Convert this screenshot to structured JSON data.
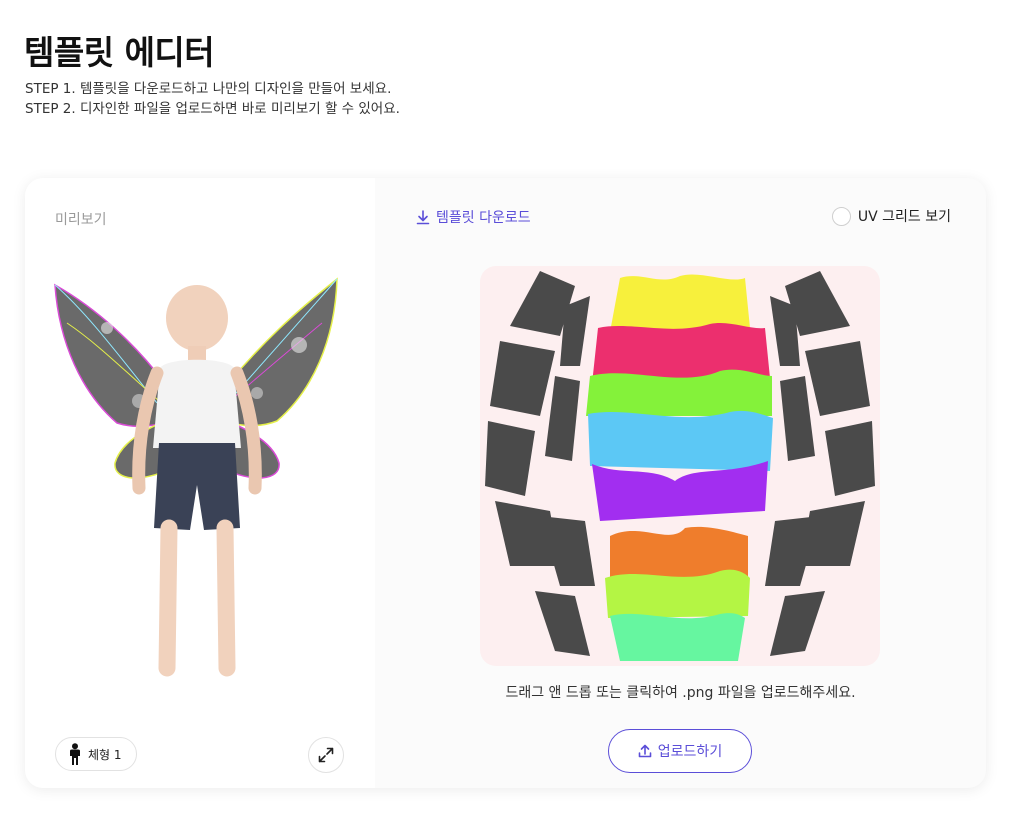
{
  "header": {
    "title": "템플릿 에디터",
    "step1": "STEP 1. 템플릿을 다운로드하고 나만의 디자인을 만들어 보세요.",
    "step2": "STEP 2. 디자인한 파일을 업로드하면 바로 미리보기 할 수 있어요."
  },
  "preview": {
    "label": "미리보기",
    "body_type_label": "체형 1",
    "body_type_icon": "person-icon",
    "expand_icon": "expand-icon"
  },
  "template": {
    "download_label": "템플릿 다운로드",
    "download_icon": "download-icon",
    "uv_grid_label": "UV 그리드 보기",
    "uv_grid_checked": false,
    "upload_hint": "드래그 앤 드롭 또는 클릭하여 .png 파일을 업로드해주세요.",
    "upload_label": "업로드하기",
    "upload_icon": "upload-icon"
  },
  "colors": {
    "accent": "#5b4ed8",
    "canvas_bg": "#fdeff0",
    "wing_gray": "#5e5e5e",
    "stripe_yellow": "#f7f03c",
    "stripe_pink": "#ec2f6e",
    "stripe_green": "#84f23a",
    "stripe_blue": "#5cc8f5",
    "stripe_purple": "#a22ef0",
    "stripe_orange": "#ef7d2c",
    "stripe_mint": "#66f6a0"
  }
}
